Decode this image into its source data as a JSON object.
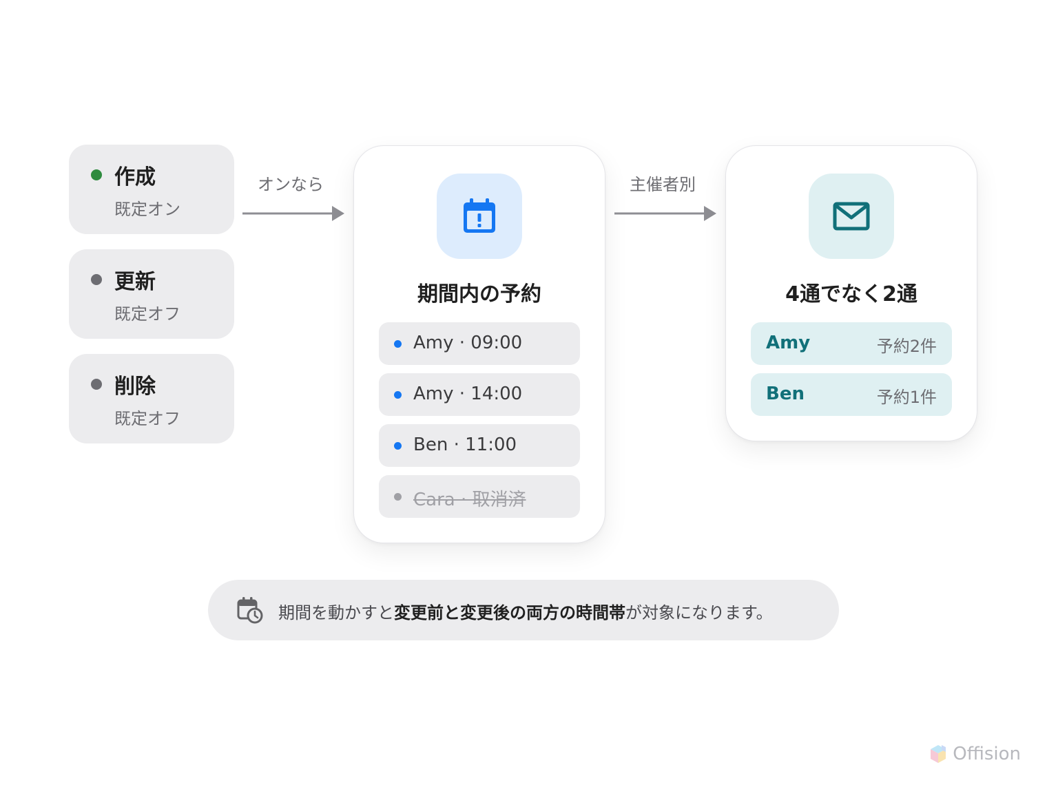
{
  "triggers": [
    {
      "title": "作成",
      "sub": "既定オン",
      "dot_color": "#2e8b3e"
    },
    {
      "title": "更新",
      "sub": "既定オフ",
      "dot_color": "#6d6d72"
    },
    {
      "title": "削除",
      "sub": "既定オフ",
      "dot_color": "#6d6d72"
    }
  ],
  "arrows": {
    "first_label": "オンなら",
    "second_label": "主催者別"
  },
  "bookings_card": {
    "title": "期間内の予約",
    "icon": "calendar-alert-icon",
    "icon_color": "#1577f2",
    "tile_color": "#ddecfd",
    "items": [
      {
        "text": "Amy · 09:00",
        "dot_color": "#1577f2",
        "cancelled": false
      },
      {
        "text": "Amy · 14:00",
        "dot_color": "#1577f2",
        "cancelled": false
      },
      {
        "text": "Ben · 11:00",
        "dot_color": "#1577f2",
        "cancelled": false
      },
      {
        "text": "Cara · 取消済",
        "dot_color": "#a0a0a5",
        "cancelled": true
      }
    ]
  },
  "emails_card": {
    "title": "4通でなく2通",
    "icon": "mail-icon",
    "icon_color": "#117079",
    "tile_color": "#dff0f2",
    "hosts": [
      {
        "name": "Amy",
        "count": "予約2件"
      },
      {
        "name": "Ben",
        "count": "予約1件"
      }
    ]
  },
  "note": {
    "icon": "calendar-clock-icon",
    "prefix": "期間を動かすと",
    "bold": "変更前と変更後の両方の時間帯",
    "suffix": "が対象になります。"
  },
  "brand": {
    "name": "Offision",
    "icon": "offision-logo-icon"
  }
}
